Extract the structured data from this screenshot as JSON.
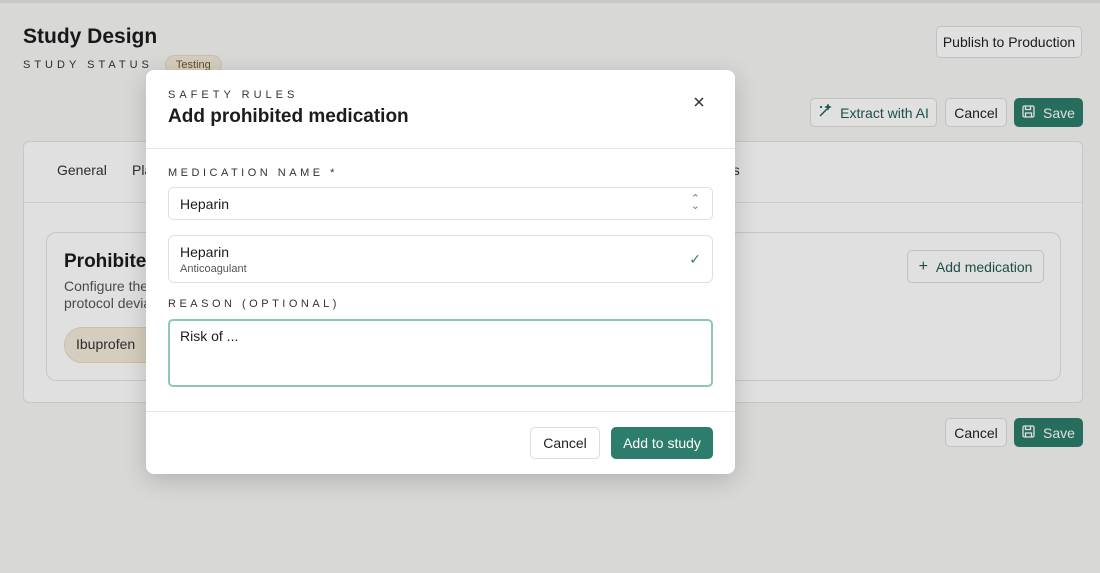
{
  "header": {
    "title": "Study Design",
    "status_label": "STUDY STATUS",
    "status_badge": "Testing",
    "publish_label": "Publish to Production"
  },
  "toolbar": {
    "extract_label": "Extract with AI",
    "cancel_label": "Cancel",
    "save_label": "Save"
  },
  "tabs": [
    {
      "label": "General"
    },
    {
      "label": "Pla"
    },
    {
      "label": "es"
    }
  ],
  "section": {
    "title": "Prohibited",
    "desc_line1": "Configure the c",
    "desc_line2": "protocol devia",
    "chip_label": "Ibuprofen",
    "add_label": "Add medication"
  },
  "footer": {
    "cancel_label": "Cancel",
    "save_label": "Save"
  },
  "modal": {
    "eyebrow": "SAFETY RULES",
    "title": "Add prohibited medication",
    "medication_label": "MEDICATION NAME *",
    "medication_value": "Heparin",
    "option_name": "Heparin",
    "option_sub": "Anticoagulant",
    "reason_label": "REASON (OPTIONAL)",
    "reason_value": "Risk of ...",
    "cancel_label": "Cancel",
    "add_label": "Add to study"
  },
  "colors": {
    "accent": "#2c7d6c",
    "badge_bg": "#f3ead8"
  }
}
